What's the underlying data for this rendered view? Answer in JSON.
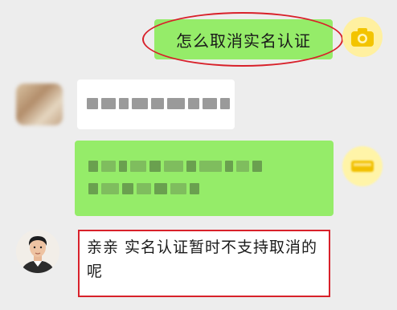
{
  "chat": {
    "messages": [
      {
        "side": "right",
        "text": "怎么取消实名认证",
        "avatar_icon": "camera-icon",
        "highlighted": true
      },
      {
        "side": "left",
        "blurred": true
      },
      {
        "side": "right",
        "blurred": true,
        "avatar_icon": "yellow-avatar-icon"
      },
      {
        "side": "left",
        "text": "亲亲 实名认证暂时不支持取消的呢",
        "avatar_icon": "user-portrait-avatar",
        "highlighted": true
      }
    ]
  },
  "colors": {
    "outgoing_bubble": "#95ec69",
    "incoming_bubble": "#ffffff",
    "highlight": "#d8212a",
    "background": "#ededed"
  }
}
